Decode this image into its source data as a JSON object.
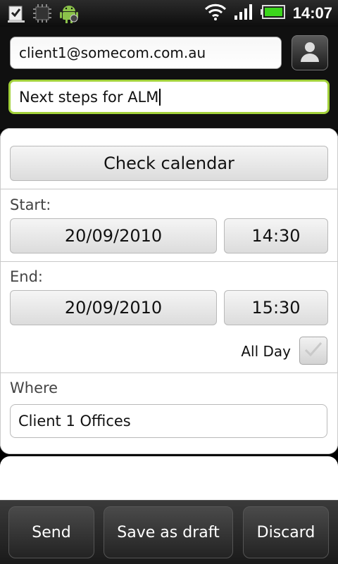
{
  "status_bar": {
    "time": "14:07",
    "notification_icons": [
      "download-complete-icon",
      "chip-icon",
      "android-debug-icon"
    ],
    "system_icons": [
      "wifi-icon",
      "signal-icon",
      "battery-icon"
    ],
    "battery_color": "#3bd51b"
  },
  "compose": {
    "to_value": "client1@somecom.com.au",
    "subject_value": "Next steps for ALM",
    "subject_focus_color": "#a2d13b"
  },
  "event": {
    "check_calendar_label": "Check calendar",
    "start_label": "Start:",
    "start_date": "20/09/2010",
    "start_time": "14:30",
    "end_label": "End:",
    "end_date": "20/09/2010",
    "end_time": "15:30",
    "all_day_label": "All Day",
    "all_day_checked": false,
    "where_label": "Where",
    "where_value": "Client 1 Offices"
  },
  "actions": {
    "send_label": "Send",
    "save_draft_label": "Save as draft",
    "discard_label": "Discard"
  }
}
